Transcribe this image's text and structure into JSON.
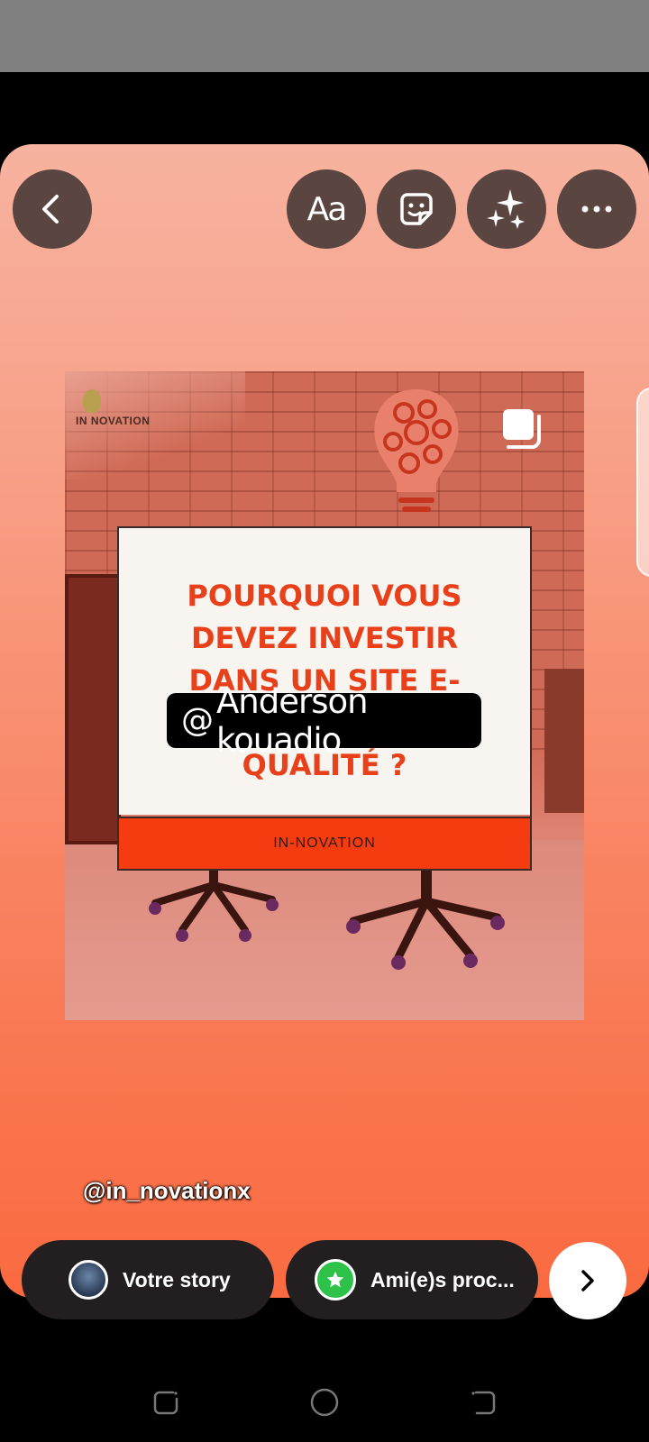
{
  "toolbar": {
    "text_tool_label": "Aa",
    "icons": [
      "back-icon",
      "sticker-icon",
      "sparkles-icon",
      "more-icon"
    ]
  },
  "post": {
    "logo_text": "IN NOVATION",
    "card_title_lines": [
      "POURQUOI VOUS",
      "DEVEZ INVESTIR",
      "DANS UN SITE E-",
      "QUALITÉ ?"
    ],
    "card_footer": "IN-NOVATION"
  },
  "threads_tag": {
    "glyph": "@",
    "text": "Anderson kouadio"
  },
  "mention": "@in_novationx",
  "share": {
    "your_story_label": "Votre story",
    "close_friends_label": "Ami(e)s proc..."
  },
  "colors": {
    "accent_orange": "#f53c10",
    "title_orange": "#e8401a",
    "close_friends_green": "#2ec24a",
    "pill_bg": "#231f20"
  }
}
